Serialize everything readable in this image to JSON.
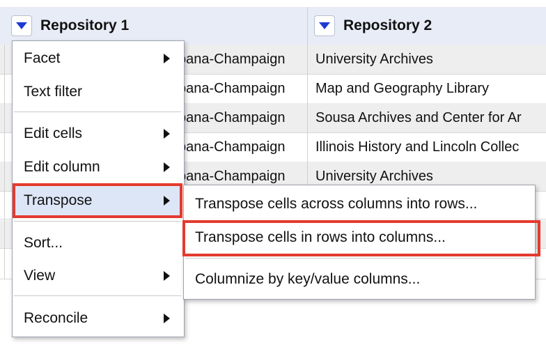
{
  "columns": [
    {
      "label": "Repository 1"
    },
    {
      "label": "Repository 2"
    }
  ],
  "rows": [
    {
      "c1": "bana-Champaign",
      "c2": "University Archives"
    },
    {
      "c1": "bana-Champaign",
      "c2": "Map and Geography Library"
    },
    {
      "c1": "bana-Champaign",
      "c2": "Sousa Archives and Center for Ar"
    },
    {
      "c1": "bana-Champaign",
      "c2": "Illinois History and Lincoln Collec"
    },
    {
      "c1": "bana-Champaign",
      "c2": "University Archives"
    }
  ],
  "menu": {
    "items": [
      {
        "label": "Facet"
      },
      {
        "label": "Text filter"
      },
      {
        "label": "Edit cells"
      },
      {
        "label": "Edit column"
      },
      {
        "label": "Transpose"
      },
      {
        "label": "Sort..."
      },
      {
        "label": "View"
      },
      {
        "label": "Reconcile"
      }
    ]
  },
  "submenu": {
    "items": [
      {
        "label": "Transpose cells across columns into rows..."
      },
      {
        "label": "Transpose cells in rows into columns..."
      },
      {
        "label": "Columnize by key/value columns..."
      }
    ]
  },
  "colors": {
    "highlight": "#e43a2f",
    "dropdown_arrow": "#1d3bd1",
    "header_bg": "#e8ecf6",
    "active_item_bg": "#dde6f7"
  },
  "icons": {
    "column_dropdown": "triangle-down-icon",
    "submenu_indicator": "triangle-right-icon"
  }
}
